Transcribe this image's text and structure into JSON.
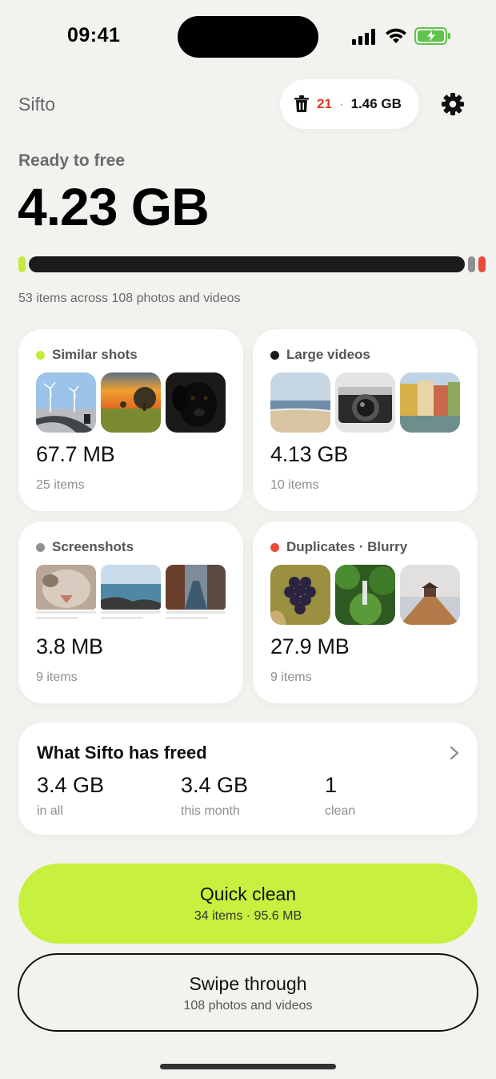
{
  "status": {
    "time": "09:41"
  },
  "header": {
    "app_title": "Sifto",
    "trash_count": "21",
    "trash_separator": "·",
    "trash_size": "1.46 GB"
  },
  "hero": {
    "label": "Ready to free",
    "size": "4.23 GB",
    "summary": "53 items across 108 photos and videos"
  },
  "colors": {
    "accent": "#c8f03e",
    "similar": "#c4ea3c",
    "large": "#1b1b1d",
    "screenshots": "#8e8e93",
    "duplicates": "#e84a3a"
  },
  "categories": [
    {
      "title": "Similar shots",
      "size": "67.7 MB",
      "count": "25 items",
      "thumbs": [
        "wind-turbine-road",
        "sunset-field",
        "black-dog"
      ]
    },
    {
      "title": "Large videos",
      "size": "4.13 GB",
      "count": "10 items",
      "thumbs": [
        "beach",
        "camera",
        "canal-houses"
      ]
    },
    {
      "title": "Screenshots",
      "size": "3.8 MB",
      "count": "9 items",
      "thumbs": [
        "cat-closeup",
        "sea-rocks",
        "city-street"
      ]
    },
    {
      "title": "Duplicates · Blurry",
      "size": "27.9 MB",
      "count": "9 items",
      "thumbs": [
        "grapes",
        "forest-waterfall",
        "pier"
      ]
    }
  ],
  "freed": {
    "title": "What Sifto has freed",
    "stats": [
      {
        "value": "3.4 GB",
        "label": "in all"
      },
      {
        "value": "3.4 GB",
        "label": "this month"
      },
      {
        "value": "1",
        "label": "clean"
      }
    ]
  },
  "quick_clean": {
    "title": "Quick clean",
    "subtitle": "34 items · 95.6 MB"
  },
  "swipe": {
    "title": "Swipe through",
    "subtitle": "108 photos and videos"
  }
}
